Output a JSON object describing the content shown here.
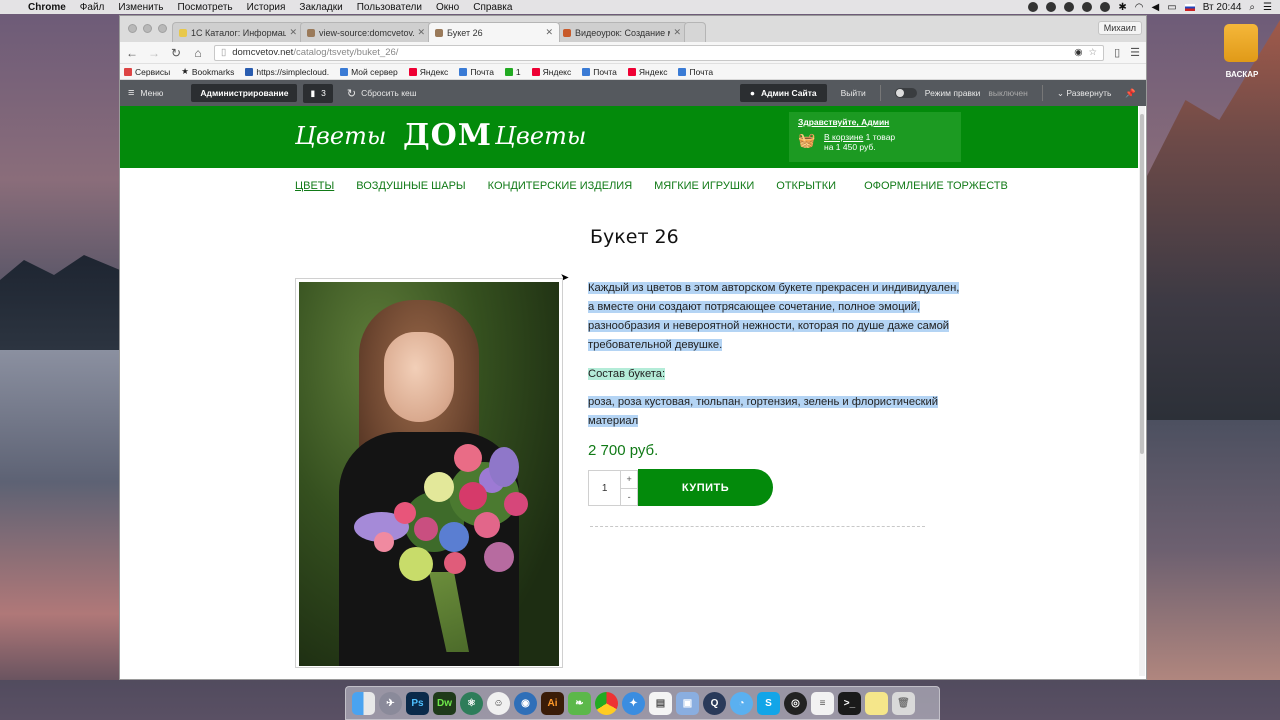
{
  "menubar": {
    "app": "Chrome",
    "items": [
      "Файл",
      "Изменить",
      "Посмотреть",
      "История",
      "Закладки",
      "Пользователи",
      "Окно",
      "Справка"
    ],
    "clock": "Вт 20:44"
  },
  "desktop": {
    "drive_label": "ВАСКАР"
  },
  "browser": {
    "tabs": [
      {
        "title": "1С Каталог: Информация"
      },
      {
        "title": "view-source:domcvetov.ne"
      },
      {
        "title": "Букет 26"
      },
      {
        "title": "Видеоурок: Создание ма"
      }
    ],
    "profile": "Михаил",
    "url_host": "domcvetov.net",
    "url_path": "/catalog/tsvety/buket_26/",
    "bookmarks": [
      {
        "label": "Сервисы",
        "color": "#d44"
      },
      {
        "label": "Bookmarks",
        "color": "#333"
      },
      {
        "label": "https://simplecloud.",
        "color": "#2a5db0"
      },
      {
        "label": "Мой сервер",
        "color": "#3a7bd5"
      },
      {
        "label": "Яндекс",
        "color": "#e03"
      },
      {
        "label": "Почта",
        "color": "#3a7bd5"
      },
      {
        "label": "1",
        "color": "#2a2"
      },
      {
        "label": "Яндекс",
        "color": "#e03"
      },
      {
        "label": "Почта",
        "color": "#3a7bd5"
      },
      {
        "label": "Яндекс",
        "color": "#e03"
      },
      {
        "label": "Почта",
        "color": "#3a7bd5"
      }
    ]
  },
  "admin": {
    "menu": "Меню",
    "administration": "Администрирование",
    "count": "3",
    "clear_cache": "Сбросить кеш",
    "site_admin": "Админ Сайта",
    "logout": "Выйти",
    "edit_mode": "Режим правки",
    "edit_state": "выключен",
    "expand": "Развернуть"
  },
  "site": {
    "logo_left": "Цветы",
    "logo_center": "ДОМ",
    "logo_right": "Цветы",
    "greeting": "Здравствуйте, Админ",
    "cart_link": "В корзине",
    "cart_count": "1 товар",
    "cart_total": "на 1 450 руб.",
    "nav": [
      "ЦВЕТЫ",
      "ВОЗДУШНЫЕ ШАРЫ",
      "КОНДИТЕРСКИЕ ИЗДЕЛИЯ",
      "МЯГКИЕ ИГРУШКИ",
      "ОТКРЫТКИ",
      "ОФОРМЛЕНИЕ ТОРЖЕСТВ"
    ]
  },
  "product": {
    "title": "Букет 26",
    "description": "Каждый из цветов в этом авторском  букете прекрасен и индивидуален, а вместе они создают потрясающее сочетание, полное эмоций, разнообразия и невероятной нежности, которая по душе даже самой требовательной девушке.",
    "composition_label": "Состав букета:",
    "composition": "роза, роза кустовая, тюльпан, гортензия, зелень и флористический материал",
    "price": "2 700 руб.",
    "quantity": "1",
    "buy_label": "КУПИТЬ"
  },
  "colors": {
    "brand_green": "#038a0b",
    "selection": "#b4d4f4"
  }
}
